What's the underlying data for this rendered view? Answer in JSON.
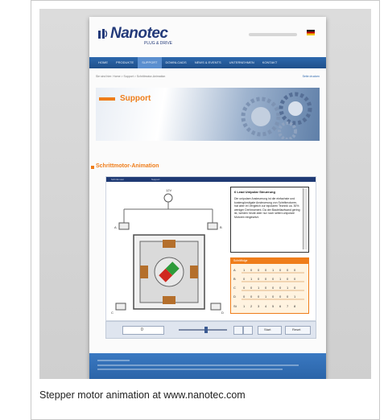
{
  "site": {
    "logo": "Nanotec",
    "logo_mark": "®",
    "tagline": "PLUG & DRIVE"
  },
  "nav": {
    "items": [
      "HOME",
      "PRODUKTE",
      "SUPPORT",
      "DOWNLOADS",
      "NEWS & EVENTS",
      "UNTERNEHMEN",
      "KONTAKT"
    ],
    "active_index": 2
  },
  "breadcrumb": "Sie sind hier: Home > Support > Schrittmotor-Animation",
  "print_label": "Seite drucken",
  "banner": {
    "title": "Support"
  },
  "section": {
    "title": "Schrittmotor-Animation"
  },
  "app": {
    "tabs": [
      "Schrittmotor",
      "Support"
    ],
    "voltage_label": "12V",
    "diagram_labels": [
      "12V",
      "A",
      "B",
      "C",
      "D"
    ],
    "info": {
      "title": "6 Lead Unipolar Steuerung",
      "text": "Die unipolare Ansteuerung ist die einfachste und kostengünstigste Ansteuerung von Schrittmotoren, hat aber im Vergleich zur bipolaren Technik ca. 30% weniger Drehmoment. Da der Bauteilaufwand gering ist, werden heute aber nur noch selten unipolare Motoren eingesetzt."
    },
    "table": {
      "header": "Schrittfolge",
      "rows": [
        [
          "A",
          "1",
          "0",
          "0",
          "0",
          "1",
          "0",
          "0",
          "0"
        ],
        [
          "B",
          "0",
          "1",
          "0",
          "0",
          "0",
          "1",
          "0",
          "0"
        ],
        [
          "C",
          "0",
          "0",
          "1",
          "0",
          "0",
          "0",
          "1",
          "0"
        ],
        [
          "D",
          "0",
          "0",
          "0",
          "1",
          "0",
          "0",
          "0",
          "1"
        ],
        [
          "St",
          "1",
          "2",
          "3",
          "4",
          "5",
          "6",
          "7",
          "8"
        ]
      ]
    },
    "controls": {
      "step_value": "0",
      "button_start": "Start",
      "button_reset": "Reset"
    }
  },
  "watermark": {
    "text": "Nanotec",
    "mark": "®"
  },
  "caption": "Stepper motor animation at www.nanotec.com",
  "colors": {
    "brand_blue": "#233a7a",
    "nav_blue": "#2d68ad",
    "accent_orange": "#ef7d1a"
  }
}
